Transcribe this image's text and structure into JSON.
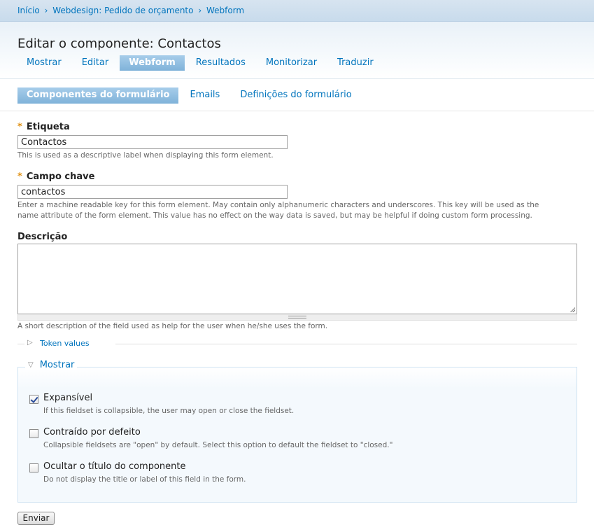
{
  "breadcrumb": {
    "items": [
      "Início",
      "Webdesign: Pedido de orçamento",
      "Webform"
    ],
    "separator": "›"
  },
  "page": {
    "title": "Editar o componente: Contactos"
  },
  "primary_tabs": [
    {
      "label": "Mostrar",
      "active": false
    },
    {
      "label": "Editar",
      "active": false
    },
    {
      "label": "Webform",
      "active": true
    },
    {
      "label": "Resultados",
      "active": false
    },
    {
      "label": "Monitorizar",
      "active": false
    },
    {
      "label": "Traduzir",
      "active": false
    }
  ],
  "secondary_tabs": [
    {
      "label": "Componentes do formulário",
      "active": true
    },
    {
      "label": "Emails",
      "active": false
    },
    {
      "label": "Definições do formulário",
      "active": false
    }
  ],
  "form": {
    "required_marker": "*",
    "etiqueta": {
      "label": "Etiqueta",
      "value": "Contactos",
      "description": "This is used as a descriptive label when displaying this form element."
    },
    "campo_chave": {
      "label": "Campo chave",
      "value": "contactos",
      "description_line1": "Enter a machine readable key for this form element. May contain only alphanumeric characters and underscores. This key will be used as the",
      "description_line2": "name attribute of the form element. This value has no effect on the way data is saved, but may be helpful if doing custom form processing."
    },
    "descricao": {
      "label": "Descrição",
      "value": "",
      "description": "A short description of the field used as help for the user when he/she uses the form."
    },
    "token_values": {
      "label": "Token values",
      "collapsed": true
    },
    "display_fieldset": {
      "legend": "Mostrar",
      "options": [
        {
          "label": "Expansível",
          "checked": true,
          "description": "If this fieldset is collapsible, the user may open or close the fieldset."
        },
        {
          "label": "Contraído por defeito",
          "checked": false,
          "description": "Collapsible fieldsets are \"open\" by default. Select this option to default the fieldset to \"closed.\""
        },
        {
          "label": "Ocultar o título do componente",
          "checked": false,
          "description": "Do not display the title or label of this field in the form."
        }
      ]
    },
    "submit_label": "Enviar"
  },
  "icons": {
    "collapsed_arrow": "triangle-right-icon",
    "expanded_arrow": "triangle-down-icon"
  },
  "colors": {
    "link": "#0074bd",
    "active_tab": "#8cbbde",
    "required": "#e09010"
  }
}
